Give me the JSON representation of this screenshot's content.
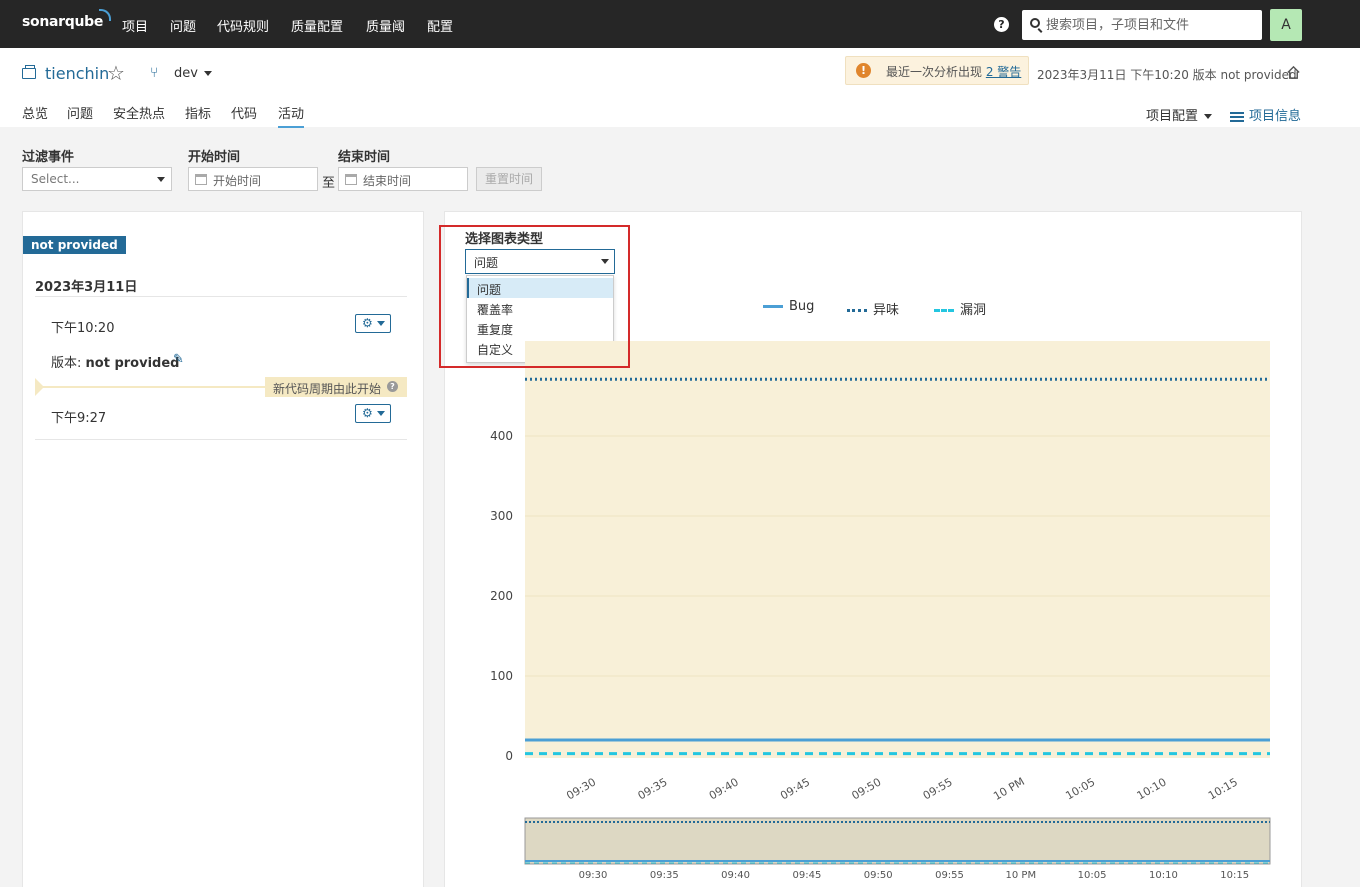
{
  "nav": {
    "logo": "sonarqube",
    "items": [
      "项目",
      "问题",
      "代码规则",
      "质量配置",
      "质量阈",
      "配置"
    ],
    "help": "?",
    "search_placeholder": "搜索项目，子项目和文件",
    "avatar": "A"
  },
  "project": {
    "name": "tienchin",
    "branch": "dev",
    "warning_prefix": "最近一次分析出现",
    "warning_link": "2 警告",
    "analysis_meta": "2023年3月11日 下午10:20  版本 not provided",
    "tabs": [
      "总览",
      "问题",
      "安全热点",
      "指标",
      "代码",
      "活动"
    ],
    "active_tab": "活动",
    "config_menu": "项目配置",
    "info_link": "项目信息"
  },
  "filters": {
    "event_label": "过滤事件",
    "event_placeholder": "Select...",
    "start_label": "开始时间",
    "start_placeholder": "开始时间",
    "to": "至",
    "end_label": "结束时间",
    "end_placeholder": "结束时间",
    "reset": "重置时间"
  },
  "activity": {
    "version_badge": "not provided",
    "date": "2023年3月11日",
    "entries": [
      {
        "time": "下午10:20"
      },
      {
        "time": "下午9:27"
      }
    ],
    "version_prefix": "版本:",
    "version_value": "not provided",
    "new_code_period": "新代码周期由此开始"
  },
  "chart_panel": {
    "type_label": "选择图表类型",
    "selected": "问题",
    "options": [
      "问题",
      "覆盖率",
      "重复度",
      "自定义"
    ],
    "colors": {
      "bug": "#4b9fd5",
      "smell": "#236a97",
      "vuln": "#24c6e0",
      "new_code_bg": "#f8f0d8",
      "minimap_bg": "#ddd8c3"
    }
  },
  "chart_data": {
    "type": "line",
    "series": [
      {
        "name": "Bug",
        "style": "solid",
        "values": [
          20,
          20
        ]
      },
      {
        "name": "异味",
        "style": "dotted",
        "values": [
          471,
          471
        ]
      },
      {
        "name": "漏洞",
        "style": "dashed",
        "values": [
          3,
          3
        ]
      }
    ],
    "x_ticks": [
      "09:30",
      "09:35",
      "09:40",
      "09:45",
      "09:50",
      "09:55",
      "10 PM",
      "10:05",
      "10:10",
      "10:15"
    ],
    "y_ticks": [
      0,
      100,
      200,
      300,
      400
    ],
    "ylim": [
      0,
      520
    ],
    "grid": true,
    "legend_position": "top"
  }
}
